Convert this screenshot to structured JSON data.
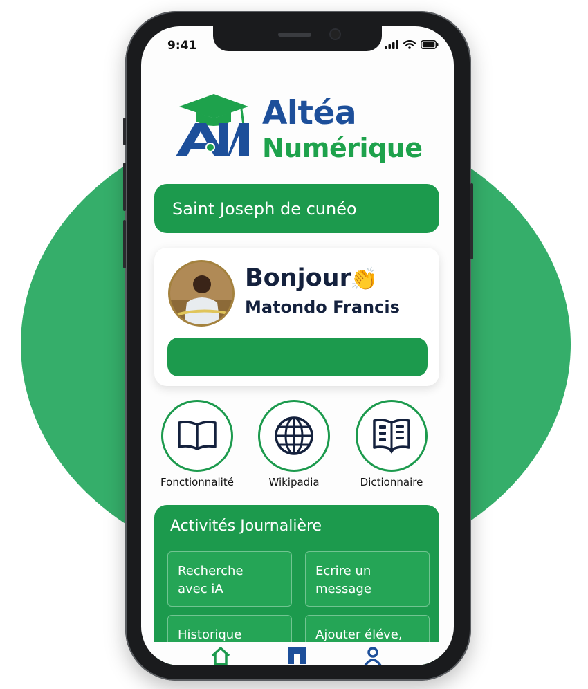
{
  "status_bar": {
    "time": "9:41"
  },
  "brand": {
    "line1": "Altéa",
    "line2": "Numérique"
  },
  "school": {
    "name": "Saint Joseph de cunéo"
  },
  "user": {
    "greeting": "Bonjour",
    "name": "Matondo Francis"
  },
  "features": [
    {
      "label": "Fonctionnalité",
      "icon": "book-icon"
    },
    {
      "label": "Wikipadia",
      "icon": "globe-icon"
    },
    {
      "label": "Dictionnaire",
      "icon": "dictionary-icon"
    }
  ],
  "activities": {
    "title": "Activités Journalière",
    "items": [
      {
        "line1": "Recherche",
        "line2": "avec iA"
      },
      {
        "line1": "Ecrire un",
        "line2": "message"
      },
      {
        "line1": "Historique",
        "line2": ""
      },
      {
        "line1": "Ajouter éléve,",
        "line2": ""
      }
    ]
  },
  "nav": {
    "items": [
      "home-icon",
      "school-icon",
      "profile-icon"
    ]
  },
  "colors": {
    "green": "#1c9a4d",
    "blue": "#1d4f9a",
    "navy": "#14213d",
    "background_circle": "#35ae6a"
  }
}
